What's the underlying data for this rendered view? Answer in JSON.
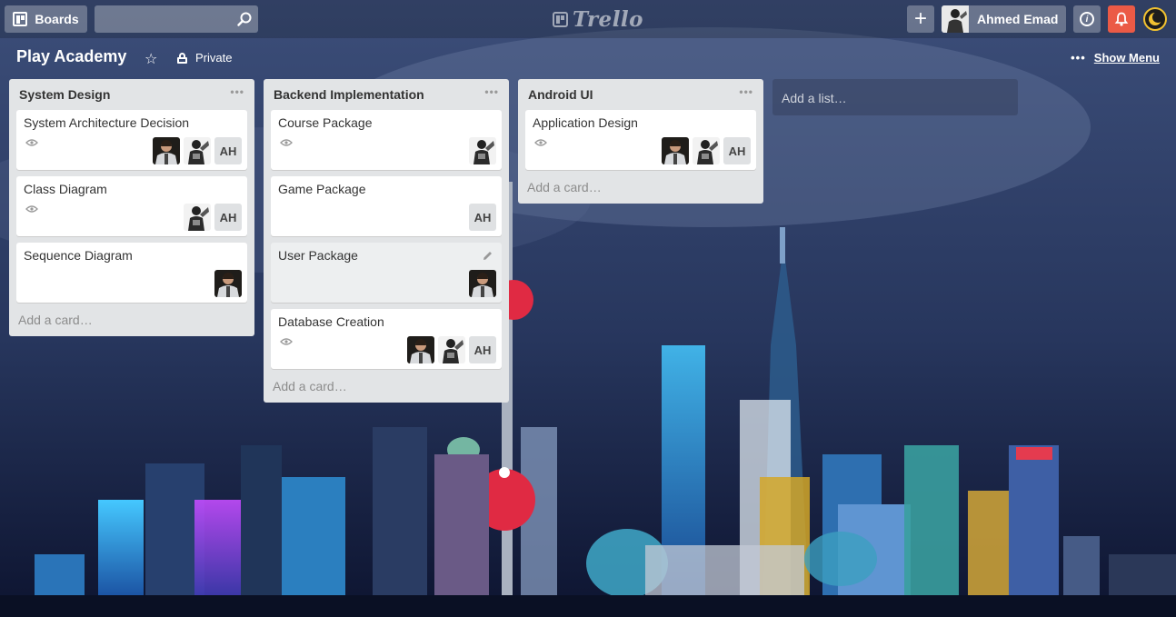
{
  "header": {
    "boards_label": "Boards",
    "search_value": "",
    "logo_text": "Trello",
    "add_label": "+",
    "user_name": "Ahmed Emad",
    "info_label": "i"
  },
  "board": {
    "title": "Play Academy",
    "visibility": "Private",
    "show_menu_label": "Show Menu"
  },
  "lists": [
    {
      "title": "System Design",
      "add_card_label": "Add a card…",
      "cards": [
        {
          "title": "System Architecture Decision",
          "watched": true,
          "members": [
            "photo-a",
            "photo-b",
            "AH"
          ]
        },
        {
          "title": "Class Diagram",
          "watched": true,
          "members": [
            "photo-b",
            "AH"
          ]
        },
        {
          "title": "Sequence Diagram",
          "watched": false,
          "members": [
            "photo-a"
          ]
        }
      ]
    },
    {
      "title": "Backend Implementation",
      "add_card_label": "Add a card…",
      "cards": [
        {
          "title": "Course Package",
          "watched": true,
          "members": [
            "photo-b"
          ]
        },
        {
          "title": "Game Package",
          "watched": false,
          "members": [
            "AH"
          ]
        },
        {
          "title": "User Package",
          "watched": false,
          "members": [
            "photo-a"
          ]
        },
        {
          "title": "Database Creation",
          "watched": true,
          "members": [
            "photo-a",
            "photo-b",
            "AH"
          ]
        }
      ]
    },
    {
      "title": "Android UI",
      "add_card_label": "Add a card…",
      "cards": [
        {
          "title": "Application Design",
          "watched": true,
          "members": [
            "photo-a",
            "photo-b",
            "AH"
          ]
        }
      ]
    }
  ],
  "add_list_label": "Add a list…",
  "initials": "AH",
  "colors": {
    "notification": "#eb5a46",
    "list_bg": "#e2e4e6",
    "moon_ring": "#f2c230"
  }
}
